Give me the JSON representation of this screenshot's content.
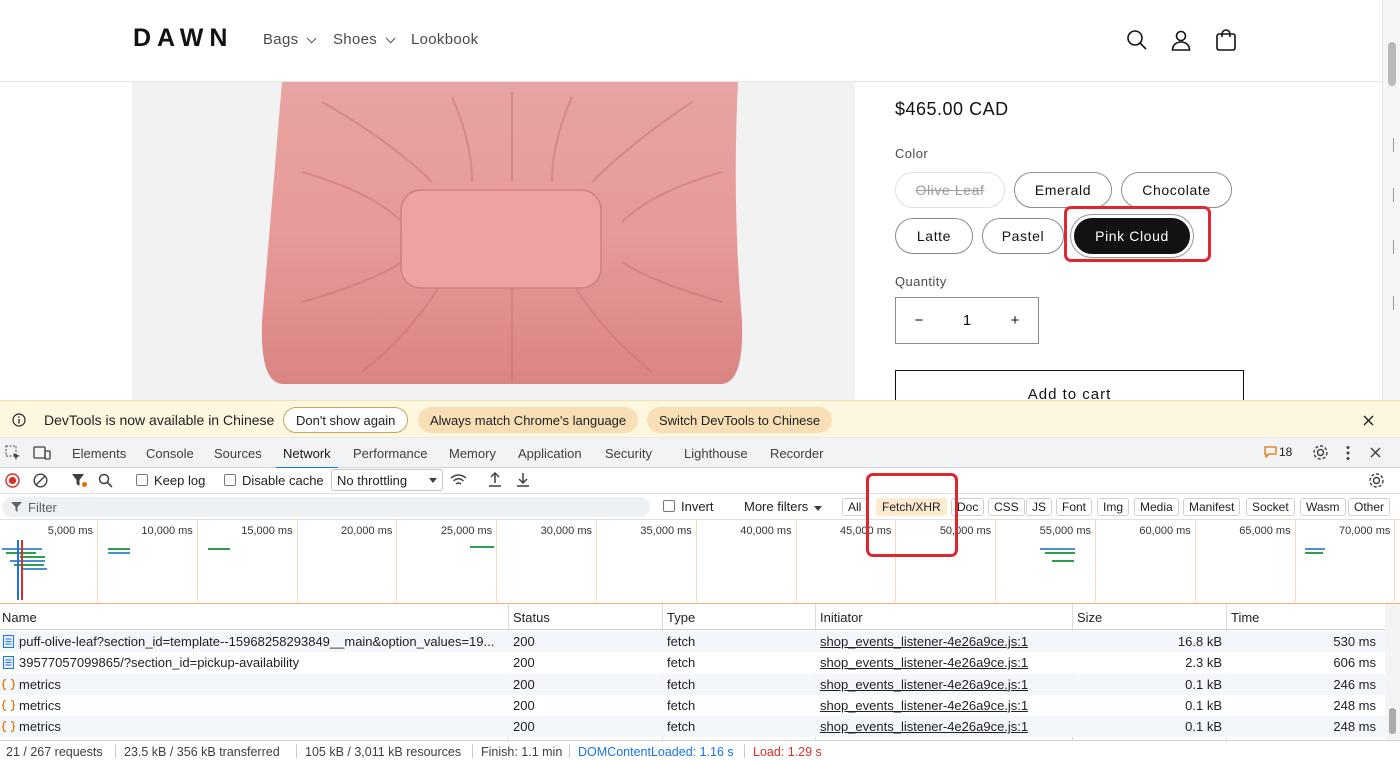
{
  "store": {
    "logo": "DAWN",
    "nav": [
      {
        "label": "Bags",
        "has_dropdown": true
      },
      {
        "label": "Shoes",
        "has_dropdown": true
      },
      {
        "label": "Lookbook",
        "has_dropdown": false
      }
    ],
    "icons": [
      "search-icon",
      "account-icon",
      "cart-icon"
    ],
    "product": {
      "image": "pink-ruched-clutch-bag",
      "price": "$465.00 CAD",
      "color_label": "Color",
      "colors": [
        {
          "label": "Olive Leaf",
          "state": "unavailable"
        },
        {
          "label": "Emerald",
          "state": "available"
        },
        {
          "label": "Chocolate",
          "state": "available"
        },
        {
          "label": "Latte",
          "state": "available"
        },
        {
          "label": "Pastel",
          "state": "available"
        },
        {
          "label": "Pink Cloud",
          "state": "selected"
        }
      ],
      "quantity_label": "Quantity",
      "quantity": "1",
      "minus": "−",
      "plus": "+",
      "add_to_cart": "Add to cart"
    }
  },
  "devtools": {
    "infobar": {
      "message": "DevTools is now available in Chinese",
      "buttons": [
        "Don't show again",
        "Always match Chrome's language",
        "Switch DevTools to Chinese"
      ]
    },
    "tabs": [
      "Elements",
      "Console",
      "Sources",
      "Network",
      "Performance",
      "Memory",
      "Application",
      "Security",
      "Lighthouse",
      "Recorder"
    ],
    "active_tab": "Network",
    "issues_count": "18",
    "toolbar": {
      "keep_log": "Keep log",
      "disable_cache": "Disable cache",
      "throttling": "No throttling"
    },
    "filter": {
      "placeholder": "Filter",
      "invert": "Invert",
      "more_filters": "More filters",
      "types": [
        "All",
        "Fetch/XHR",
        "Doc",
        "CSS",
        "JS",
        "Font",
        "Img",
        "Media",
        "Manifest",
        "Socket",
        "Wasm",
        "Other"
      ],
      "active_type": "Fetch/XHR"
    },
    "timeline_ticks": [
      "5,000 ms",
      "10,000 ms",
      "15,000 ms",
      "20,000 ms",
      "25,000 ms",
      "30,000 ms",
      "35,000 ms",
      "40,000 ms",
      "45,000 ms",
      "50,000 ms",
      "55,000 ms",
      "60,000 ms",
      "65,000 ms",
      "70,000 ms"
    ],
    "columns": [
      "Name",
      "Status",
      "Type",
      "Initiator",
      "Size",
      "Time"
    ],
    "rows": [
      {
        "name": "puff-olive-leaf?section_id=template--15968258293849__main&option_values=19...",
        "status": "200",
        "type": "fetch",
        "initiator": "shop_events_listener-4e26a9ce.js:1",
        "size": "16.8 kB",
        "time": "530 ms",
        "icon": "document-icon"
      },
      {
        "name": "39577057099865/?section_id=pickup-availability",
        "status": "200",
        "type": "fetch",
        "initiator": "shop_events_listener-4e26a9ce.js:1",
        "size": "2.3 kB",
        "time": "606 ms",
        "icon": "document-icon"
      },
      {
        "name": "metrics",
        "status": "200",
        "type": "fetch",
        "initiator": "shop_events_listener-4e26a9ce.js:1",
        "size": "0.1 kB",
        "time": "246 ms",
        "icon": "fetch-icon"
      },
      {
        "name": "metrics",
        "status": "200",
        "type": "fetch",
        "initiator": "shop_events_listener-4e26a9ce.js:1",
        "size": "0.1 kB",
        "time": "248 ms",
        "icon": "fetch-icon"
      },
      {
        "name": "metrics",
        "status": "200",
        "type": "fetch",
        "initiator": "shop_events_listener-4e26a9ce.js:1",
        "size": "0.1 kB",
        "time": "248 ms",
        "icon": "fetch-icon"
      }
    ],
    "status_bar": {
      "requests": "21 / 267 requests",
      "transferred": "23.5 kB / 356 kB transferred",
      "resources": "105 kB / 3,011 kB resources",
      "finish": "Finish: 1.1 min",
      "dom_content_loaded": "DOMContentLoaded: 1.16 s",
      "load": "Load: 1.29 s"
    }
  },
  "colors": {
    "accent_blue": "#1a73e8",
    "highlight_red": "#e0262e",
    "infobar_bg": "#fef7e0",
    "chip_active": "#fdebd0",
    "dcl_blue": "#1a73e8",
    "load_red": "#d93025"
  }
}
